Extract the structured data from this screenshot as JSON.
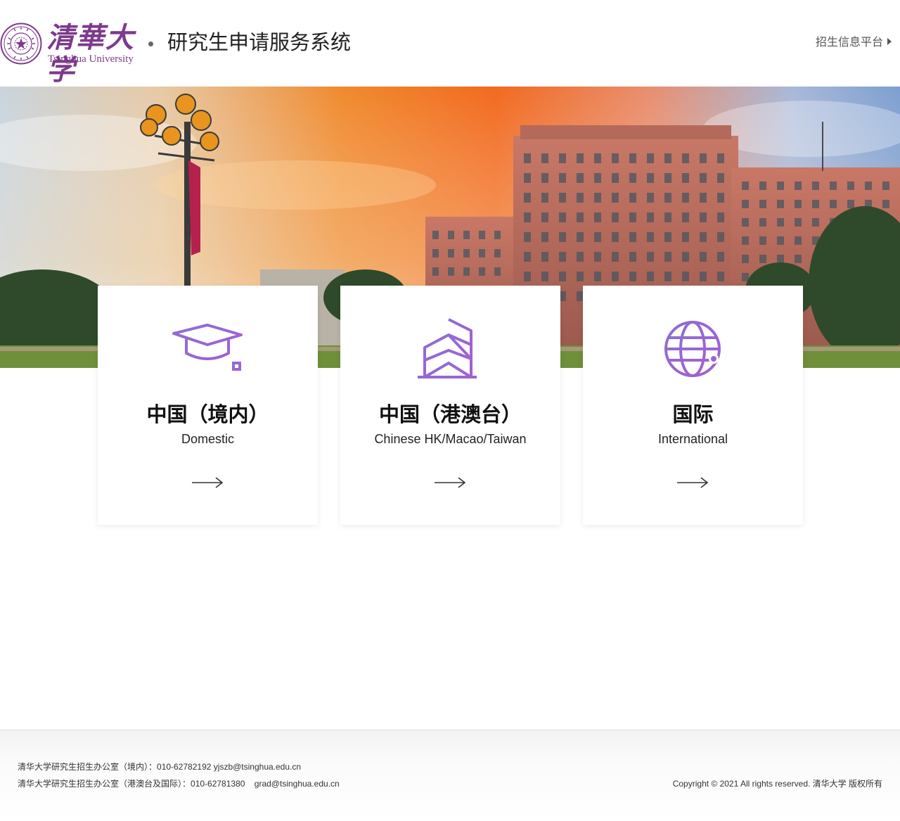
{
  "header": {
    "logo_cn": "清華大学",
    "logo_en": "Tsinghua University",
    "system_title": "研究生申请服务系统",
    "nav_link": "招生信息平台"
  },
  "cards": [
    {
      "title_cn": "中国（境内）",
      "title_en": "Domestic",
      "icon": "graduation-cap-icon"
    },
    {
      "title_cn": "中国（港澳台）",
      "title_en": "Chinese HK/Macao/Taiwan",
      "icon": "building-icon"
    },
    {
      "title_cn": "国际",
      "title_en": "International",
      "icon": "globe-icon"
    }
  ],
  "footer": {
    "line1_office": "清华大学研究生招生办公室（境内）：",
    "line1_phone": "010-62782192",
    "line1_email": "yjszb@tsinghua.edu.cn",
    "line2_office": "清华大学研究生招生办公室（港澳台及国际）：",
    "line2_phone": "010-62781380",
    "line2_email": "grad@tsinghua.edu.cn",
    "copyright": "Copyright © 2021 All rights reserved. 清华大学 版权所有"
  },
  "colors": {
    "brand_purple": "#7d3a8c",
    "icon_gradient_start": "#8b6fd6",
    "icon_gradient_end": "#a55fd0"
  }
}
